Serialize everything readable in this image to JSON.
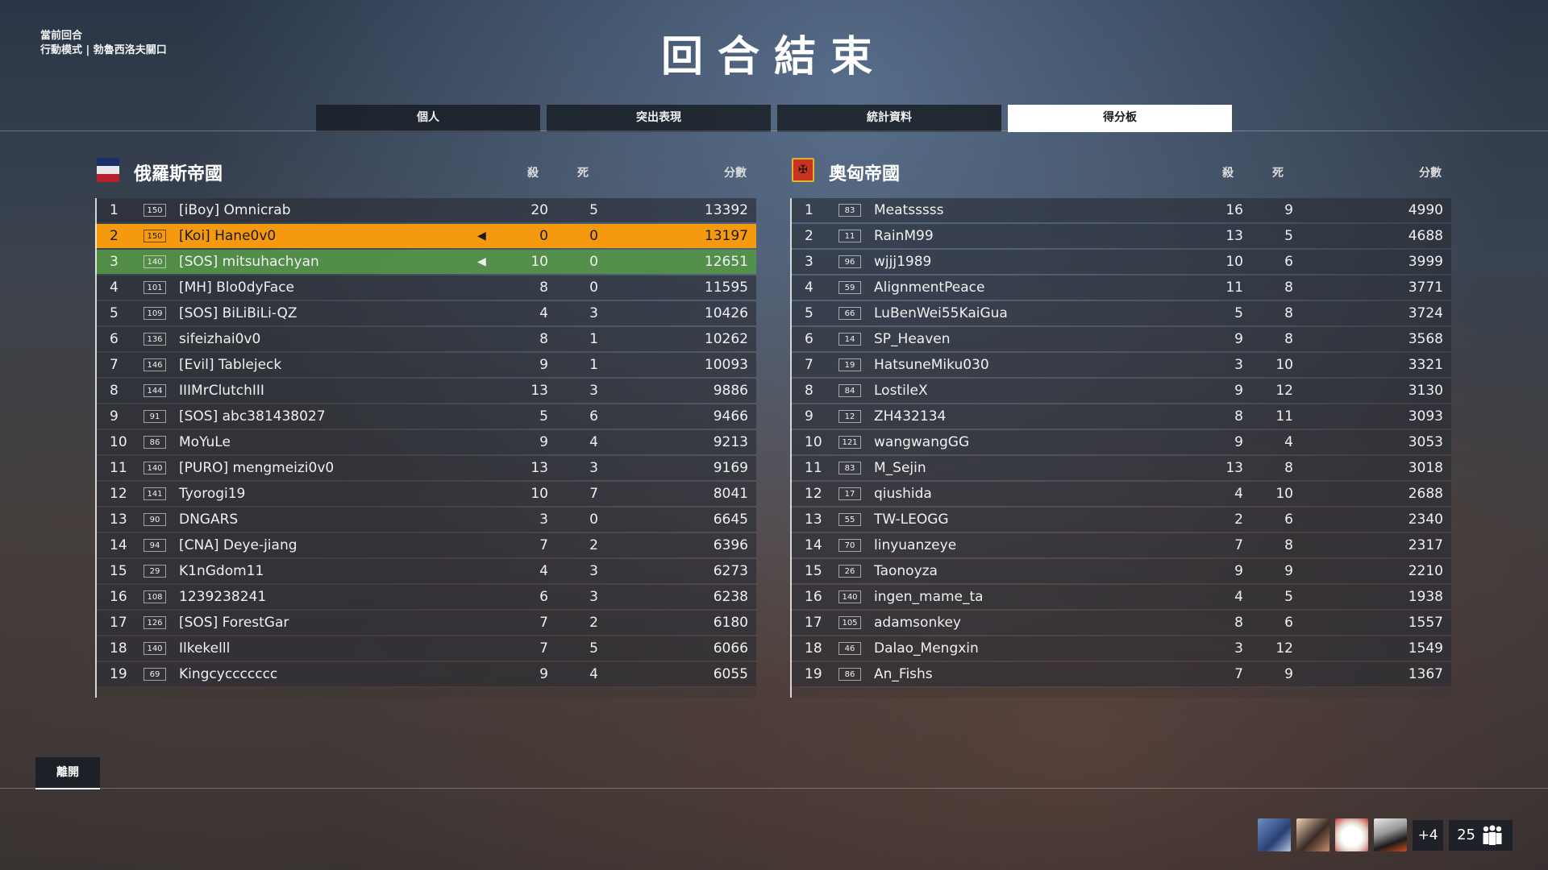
{
  "round_info": {
    "label": "當前回合",
    "mode": "行動模式 | 勃魯西洛夫關口"
  },
  "title": "回合結束",
  "tabs": [
    "個人",
    "突出表現",
    "統計資料",
    "得分板"
  ],
  "active_tab": 3,
  "teams": [
    {
      "name": "俄羅斯帝國",
      "headers": {
        "kills": "殺",
        "deaths": "死",
        "score": "分數"
      },
      "players": [
        {
          "pos": "1",
          "rank": "150",
          "name": "[iBoy] Omnicrab",
          "k": "20",
          "d": "5",
          "s": "13392"
        },
        {
          "pos": "2",
          "rank": "150",
          "name": "[Koi] Hane0v0",
          "k": "0",
          "d": "0",
          "s": "13197"
        },
        {
          "pos": "3",
          "rank": "140",
          "name": "[SOS] mitsuhachyan",
          "k": "10",
          "d": "0",
          "s": "12651"
        },
        {
          "pos": "4",
          "rank": "101",
          "name": "[MH] Blo0dyFace",
          "k": "8",
          "d": "0",
          "s": "11595"
        },
        {
          "pos": "5",
          "rank": "109",
          "name": "[SOS] BiLiBiLi-QZ",
          "k": "4",
          "d": "3",
          "s": "10426"
        },
        {
          "pos": "6",
          "rank": "136",
          "name": "sifeizhai0v0",
          "k": "8",
          "d": "1",
          "s": "10262"
        },
        {
          "pos": "7",
          "rank": "146",
          "name": "[Evil] Tablejeck",
          "k": "9",
          "d": "1",
          "s": "10093"
        },
        {
          "pos": "8",
          "rank": "144",
          "name": "IIIMrClutchIII",
          "k": "13",
          "d": "3",
          "s": "9886"
        },
        {
          "pos": "9",
          "rank": "91",
          "name": "[SOS] abc381438027",
          "k": "5",
          "d": "6",
          "s": "9466"
        },
        {
          "pos": "10",
          "rank": "86",
          "name": "MoYuLe",
          "k": "9",
          "d": "4",
          "s": "9213"
        },
        {
          "pos": "11",
          "rank": "140",
          "name": "[PURO] mengmeizi0v0",
          "k": "13",
          "d": "3",
          "s": "9169"
        },
        {
          "pos": "12",
          "rank": "141",
          "name": "Tyorogi19",
          "k": "10",
          "d": "7",
          "s": "8041"
        },
        {
          "pos": "13",
          "rank": "90",
          "name": "DNGARS",
          "k": "3",
          "d": "0",
          "s": "6645"
        },
        {
          "pos": "14",
          "rank": "94",
          "name": "[CNA] Deye-jiang",
          "k": "7",
          "d": "2",
          "s": "6396"
        },
        {
          "pos": "15",
          "rank": "29",
          "name": "K1nGdom11",
          "k": "4",
          "d": "3",
          "s": "6273"
        },
        {
          "pos": "16",
          "rank": "108",
          "name": "1239238241",
          "k": "6",
          "d": "3",
          "s": "6238"
        },
        {
          "pos": "17",
          "rank": "126",
          "name": "[SOS] ForestGar",
          "k": "7",
          "d": "2",
          "s": "6180"
        },
        {
          "pos": "18",
          "rank": "140",
          "name": "Ilkekelll",
          "k": "7",
          "d": "5",
          "s": "6066"
        },
        {
          "pos": "19",
          "rank": "69",
          "name": "Kingcyccccccc",
          "k": "9",
          "d": "4",
          "s": "6055"
        }
      ]
    },
    {
      "name": "奧匈帝國",
      "headers": {
        "kills": "殺",
        "deaths": "死",
        "score": "分數"
      },
      "players": [
        {
          "pos": "1",
          "rank": "83",
          "name": "Meatsssss",
          "k": "16",
          "d": "9",
          "s": "4990"
        },
        {
          "pos": "2",
          "rank": "11",
          "name": "RainM99",
          "k": "13",
          "d": "5",
          "s": "4688"
        },
        {
          "pos": "3",
          "rank": "96",
          "name": "wjjj1989",
          "k": "10",
          "d": "6",
          "s": "3999"
        },
        {
          "pos": "4",
          "rank": "59",
          "name": "AlignmentPeace",
          "k": "11",
          "d": "8",
          "s": "3771"
        },
        {
          "pos": "5",
          "rank": "66",
          "name": "LuBenWei55KaiGua",
          "k": "5",
          "d": "8",
          "s": "3724"
        },
        {
          "pos": "6",
          "rank": "14",
          "name": "SP_Heaven",
          "k": "9",
          "d": "8",
          "s": "3568"
        },
        {
          "pos": "7",
          "rank": "19",
          "name": "HatsuneMiku030",
          "k": "3",
          "d": "10",
          "s": "3321"
        },
        {
          "pos": "8",
          "rank": "84",
          "name": "LostileX",
          "k": "9",
          "d": "12",
          "s": "3130"
        },
        {
          "pos": "9",
          "rank": "12",
          "name": "ZH432134",
          "k": "8",
          "d": "11",
          "s": "3093"
        },
        {
          "pos": "10",
          "rank": "121",
          "name": "wangwangGG",
          "k": "9",
          "d": "4",
          "s": "3053"
        },
        {
          "pos": "11",
          "rank": "83",
          "name": "M_Sejin",
          "k": "13",
          "d": "8",
          "s": "3018"
        },
        {
          "pos": "12",
          "rank": "17",
          "name": "qiushida",
          "k": "4",
          "d": "10",
          "s": "2688"
        },
        {
          "pos": "13",
          "rank": "55",
          "name": "TW-LEOGG",
          "k": "2",
          "d": "6",
          "s": "2340"
        },
        {
          "pos": "14",
          "rank": "70",
          "name": "linyuanzeye",
          "k": "7",
          "d": "8",
          "s": "2317"
        },
        {
          "pos": "15",
          "rank": "26",
          "name": "Taonoyza",
          "k": "9",
          "d": "9",
          "s": "2210"
        },
        {
          "pos": "16",
          "rank": "140",
          "name": "ingen_mame_ta",
          "k": "4",
          "d": "5",
          "s": "1938"
        },
        {
          "pos": "17",
          "rank": "105",
          "name": "adamsonkey",
          "k": "8",
          "d": "6",
          "s": "1557"
        },
        {
          "pos": "18",
          "rank": "46",
          "name": "Dalao_Mengxin",
          "k": "3",
          "d": "12",
          "s": "1549"
        },
        {
          "pos": "19",
          "rank": "86",
          "name": "An_Fishs",
          "k": "7",
          "d": "9",
          "s": "1367"
        }
      ]
    }
  ],
  "leave_label": "離開",
  "squad": {
    "more_label": "+4",
    "count": "25"
  },
  "colors": {
    "self_row": "#f59a0e",
    "squad_row": "#549648"
  }
}
